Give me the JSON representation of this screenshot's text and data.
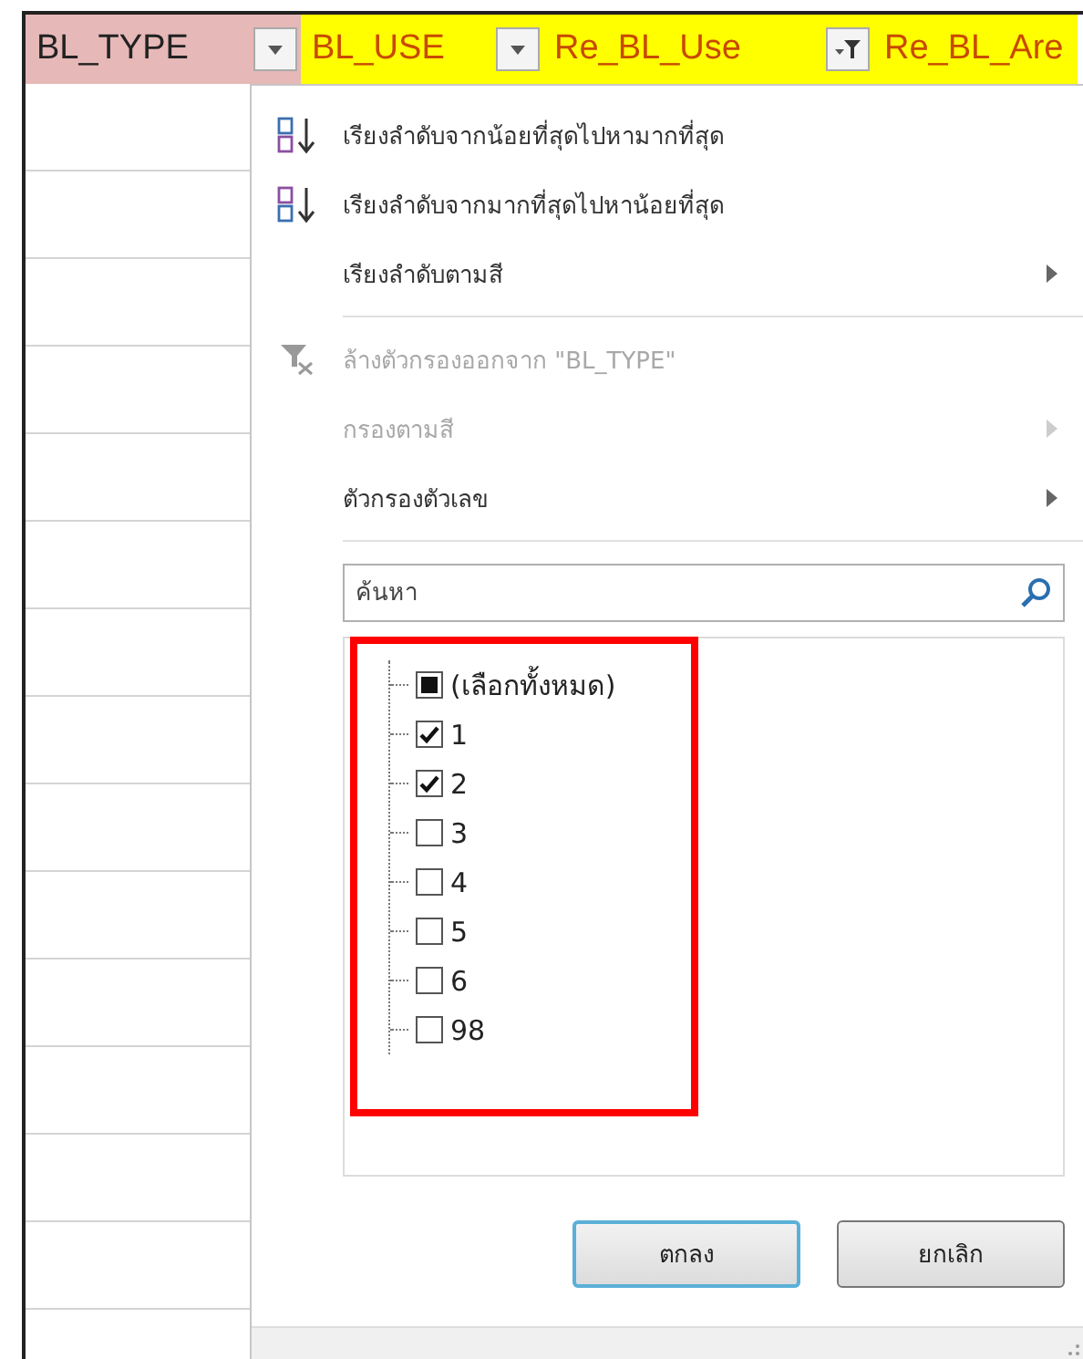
{
  "headers": [
    {
      "label": "BL_TYPE",
      "color": "#e6b8b7",
      "filtered": false
    },
    {
      "label": "BL_USE",
      "color": "#ffff00",
      "filtered": false
    },
    {
      "label": "Re_BL_Use",
      "color": "#ffff00",
      "filtered": true
    },
    {
      "label": "Re_BL_Are",
      "color": "#ffff00"
    }
  ],
  "menu": {
    "items": [
      {
        "kind": "sort-asc",
        "label": "เรียงลำดับจากน้อยที่สุดไปหามากที่สุด",
        "disabled": false,
        "submenu": false
      },
      {
        "kind": "sort-desc",
        "label": "เรียงลำดับจากมากที่สุดไปหาน้อยที่สุด",
        "disabled": false,
        "submenu": false
      },
      {
        "kind": "plain",
        "label": "เรียงลำดับตามสี",
        "disabled": false,
        "submenu": true
      },
      {
        "kind": "separator"
      },
      {
        "kind": "clear-filter",
        "label": "ล้างตัวกรองออกจาก \"BL_TYPE\"",
        "disabled": true,
        "submenu": false
      },
      {
        "kind": "plain",
        "label": "กรองตามสี",
        "disabled": true,
        "submenu": true
      },
      {
        "kind": "plain",
        "label": "ตัวกรองตัวเลข",
        "disabled": false,
        "submenu": true
      },
      {
        "kind": "separator"
      }
    ],
    "search": {
      "placeholder": "ค้นหา"
    },
    "values": [
      {
        "label": "(เลือกทั้งหมด)",
        "checked": true,
        "partial": true
      },
      {
        "label": "1",
        "checked": true
      },
      {
        "label": "2",
        "checked": true
      },
      {
        "label": "3",
        "checked": false
      },
      {
        "label": "4",
        "checked": false
      },
      {
        "label": "5",
        "checked": false
      },
      {
        "label": "6",
        "checked": false
      },
      {
        "label": "98",
        "checked": false
      }
    ],
    "buttons": [
      {
        "label": "ตกลง",
        "default": true
      },
      {
        "label": "ยกเลิก",
        "default": false
      }
    ]
  }
}
